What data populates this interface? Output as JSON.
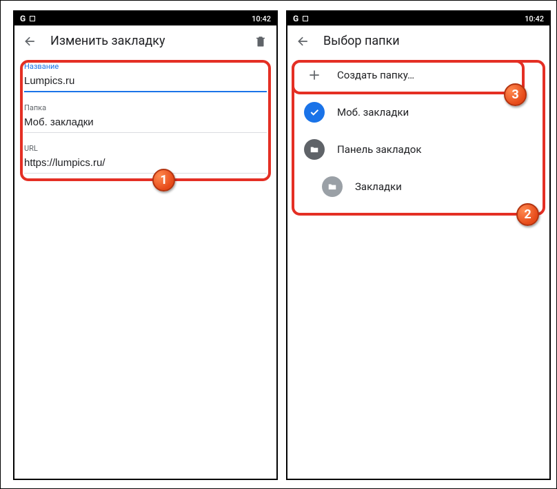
{
  "status": {
    "time": "10:42",
    "google_icon": "G"
  },
  "left": {
    "title": "Изменить закладку",
    "name_label": "Название",
    "name_value": "Lumpics.ru",
    "folder_label": "Папка",
    "folder_value": "Моб. закладки",
    "url_label": "URL",
    "url_value": "https://lumpics.ru/"
  },
  "right": {
    "title": "Выбор папки",
    "create_label": "Создать папку…",
    "items": [
      {
        "label": "Моб. закладки"
      },
      {
        "label": "Панель закладок"
      },
      {
        "label": "Закладки"
      }
    ]
  },
  "badges": {
    "b1": "1",
    "b2": "2",
    "b3": "3"
  }
}
